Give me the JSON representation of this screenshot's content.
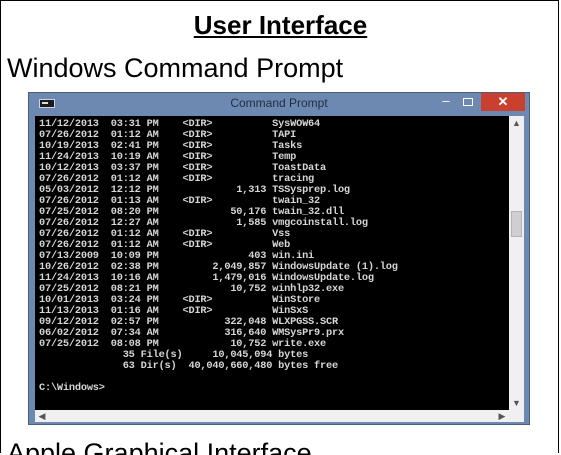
{
  "slide": {
    "title": "User Interface",
    "subtitle": "Windows Command Prompt",
    "bottom_caption": "Apple Graphical Interface"
  },
  "window": {
    "title": "Command Prompt",
    "minimize_glyph": "–",
    "close_glyph": "✕",
    "title_bar_color": "#6e89b1",
    "close_color": "#c9402f"
  },
  "console": {
    "lines": [
      "11/12/2013  03:31 PM    <DIR>          SysWOW64",
      "07/26/2012  01:12 AM    <DIR>          TAPI",
      "10/19/2013  02:41 PM    <DIR>          Tasks",
      "11/24/2013  10:19 AM    <DIR>          Temp",
      "10/12/2013  03:37 PM    <DIR>          ToastData",
      "07/26/2012  01:12 AM    <DIR>          tracing",
      "05/03/2012  12:12 PM             1,313 TSSysprep.log",
      "07/26/2012  01:13 AM    <DIR>          twain_32",
      "07/25/2012  08:20 PM            50,176 twain_32.dll",
      "07/26/2012  12:27 AM             1,585 vmgcoinstall.log",
      "07/26/2012  01:12 AM    <DIR>          Vss",
      "07/26/2012  01:12 AM    <DIR>          Web",
      "07/13/2009  10:09 PM               403 win.ini",
      "10/26/2012  02:38 PM         2,049,857 WindowsUpdate (1).log",
      "11/24/2013  10:16 AM         1,479,016 WindowsUpdate.log",
      "07/25/2012  08:21 PM            10,752 winhlp32.exe",
      "10/01/2013  03:24 PM    <DIR>          WinStore",
      "11/13/2013  01:16 AM    <DIR>          WinSxS",
      "09/12/2012  02:57 PM           322,048 WLXPGSS.SCR",
      "06/02/2012  07:34 AM           316,640 WMSysPr9.prx",
      "07/25/2012  08:08 PM            10,752 write.exe",
      "              35 File(s)     10,045,094 bytes",
      "              63 Dir(s)  40,040,660,480 bytes free",
      "",
      "C:\\Windows>"
    ]
  },
  "scrollbars": {
    "up_arrow": "▲",
    "down_arrow": "▼",
    "left_arrow": "◀",
    "right_arrow": "▶"
  }
}
